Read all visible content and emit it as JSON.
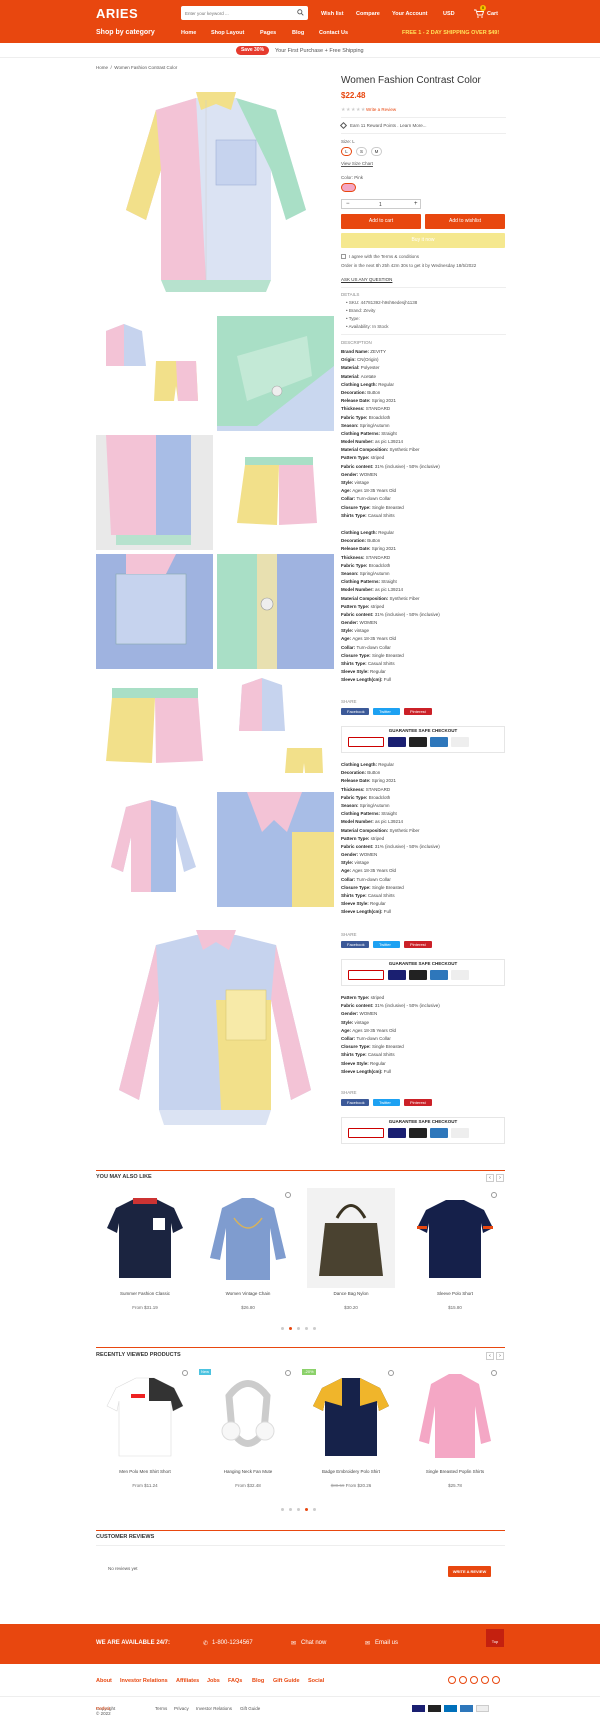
{
  "header": {
    "logo": "ARIES",
    "search_placeholder": "Enter your keyword ...",
    "wishlist": "Wish list",
    "compare": "Compare",
    "account": "Your Account",
    "currency": "USD",
    "cart": "Cart",
    "cart_count": "0"
  },
  "nav": {
    "category": "Shop by category",
    "items": [
      "Home",
      "Shop Layout",
      "Pages",
      "Blog",
      "Contact Us"
    ],
    "shipping": "FREE 1 - 2 DAY SHIPPING OVER $49!"
  },
  "promo": {
    "badge": "Save 30%",
    "text": "Your First Purchase + Free Shipping"
  },
  "breadcrumb": {
    "home": "Home",
    "current": "Women Fashion Contrast Color"
  },
  "product": {
    "title": "Women Fashion Contrast Color",
    "price": "$22.48",
    "write_review": "Write a Review",
    "rewards": "Earn 11 Reward Points . Learn More...",
    "size_label": "Size: L",
    "sizes": [
      "L",
      "S",
      "M"
    ],
    "size_chart": "View Size Chart",
    "color_label": "Color: Pink",
    "quantity": "1",
    "add_to_cart": "Add to cart",
    "add_to_wishlist": "Add to wishlist",
    "buy_now": "Buy it now",
    "terms": "I agree with the Terms & conditions",
    "order_text": "Order in the next 8h 25h 42m 30s to get it by Wednesday 18/5/2022",
    "ask": "ASK US ANY QUESTION",
    "details_label": "DETAILS",
    "details": [
      "SKU: 44781392-h9sh6edesjh1138",
      "Brand: Zevity",
      "Type:",
      "Availability: In Stock"
    ],
    "description_label": "DESCRIPTION",
    "share_label": "SHARE",
    "guarantee": "GUARANTEE SAFE CHECKOUT",
    "facebook": "Facebook",
    "twitter": "Twitter",
    "pinterest": "Pinterest"
  },
  "spec_main": [
    [
      "Brand Name:",
      "ZEVITY"
    ],
    [
      "Origin:",
      "CN(Origin)"
    ],
    [
      "Material:",
      "Polyester"
    ],
    [
      "Material:",
      "Acetate"
    ],
    [
      "Clothing Length:",
      "Regular"
    ],
    [
      "Decoration:",
      "Button"
    ],
    [
      "Release Date:",
      "Spring 2021"
    ],
    [
      "Thickness:",
      "STANDARD"
    ],
    [
      "Fabric Type:",
      "Broadcloth"
    ],
    [
      "Season:",
      "Spring/Autumn"
    ],
    [
      "Clothing Patterns:",
      "Straight"
    ],
    [
      "Model Number:",
      "as pic L39214"
    ],
    [
      "Material Composition:",
      "Synthetic Fiber"
    ],
    [
      "Pattern Type:",
      "striped"
    ],
    [
      "Fabric content:",
      "31% (inclusive) - 50% (inclusive)"
    ],
    [
      "Gender:",
      "WOMEN"
    ],
    [
      "Style:",
      "vintage"
    ],
    [
      "Age:",
      "Ages 18-35 Years Old"
    ],
    [
      "Collar:",
      "Turn-down Collar"
    ],
    [
      "Closure Type:",
      "Single Breasted"
    ],
    [
      "Shirts Type:",
      "Casual Shirts"
    ]
  ],
  "spec_b": [
    [
      "Clothing Length:",
      "Regular"
    ],
    [
      "Decoration:",
      "Button"
    ],
    [
      "Release Date:",
      "Spring 2021"
    ],
    [
      "Thickness:",
      "STANDARD"
    ],
    [
      "Fabric Type:",
      "Broadcloth"
    ],
    [
      "Season:",
      "Spring/Autumn"
    ],
    [
      "Clothing Patterns:",
      "Straight"
    ],
    [
      "Model Number:",
      "as pic L39214"
    ],
    [
      "Material Composition:",
      "Synthetic Fiber"
    ],
    [
      "Pattern Type:",
      "striped"
    ],
    [
      "Fabric content:",
      "31% (inclusive) - 50% (inclusive)"
    ],
    [
      "Gender:",
      "WOMEN"
    ],
    [
      "Style:",
      "vintage"
    ],
    [
      "Age:",
      "Ages 18-35 Years Old"
    ],
    [
      "Collar:",
      "Turn-down Collar"
    ],
    [
      "Closure Type:",
      "Single Breasted"
    ],
    [
      "Shirts Type:",
      "Casual Shirts"
    ],
    [
      "Sleeve Style:",
      "Regular"
    ],
    [
      "Sleeve Length(cm):",
      "Full"
    ]
  ],
  "spec_c": [
    [
      "Pattern Type:",
      "striped"
    ],
    [
      "Fabric content:",
      "31% (inclusive) - 50% (inclusive)"
    ],
    [
      "Gender:",
      "WOMEN"
    ],
    [
      "Style:",
      "vintage"
    ],
    [
      "Age:",
      "Ages 18-35 Years Old"
    ],
    [
      "Collar:",
      "Turn-down Collar"
    ],
    [
      "Closure Type:",
      "Single Breasted"
    ],
    [
      "Shirts Type:",
      "Casual Shirts"
    ],
    [
      "Sleeve Style:",
      "Regular"
    ],
    [
      "Sleeve Length(cm):",
      "Full"
    ]
  ],
  "also_like": {
    "title": "YOU MAY ALSO LIKE",
    "items": [
      {
        "name": "Summer Fashion Classic",
        "price": "From $31.19"
      },
      {
        "name": "Women Vintage Chain",
        "price": "$26.80"
      },
      {
        "name": "Dance Bag Nylon",
        "price": "$30.20"
      },
      {
        "name": "Sleeve Polo Short",
        "price": "$15.80"
      }
    ]
  },
  "recent": {
    "title": "RECENTLY VIEWED PRODUCTS",
    "items": [
      {
        "name": "Men Polo Men Shirt Short",
        "price": "From $11.24"
      },
      {
        "name": "Hanging Neck Fan Mute",
        "price": "From $32.48",
        "tag": "New"
      },
      {
        "name": "Badge Embroidery Polo Shirt",
        "old": "$80.59",
        "price": "From $20.26",
        "tag": "-20%"
      },
      {
        "name": "Single Breasted Poplin Shirts",
        "price": "$25.78"
      }
    ]
  },
  "reviews": {
    "title": "CUSTOMER REVIEWS",
    "none": "No reviews yet",
    "write": "WRITE A REVIEW"
  },
  "footer": {
    "available": "WE ARE AVAILABLE 24/7:",
    "phone": "1-800-1234567",
    "chat": "Chat now",
    "email": "Email us",
    "top": "Top",
    "links": [
      "About",
      "Investor Relations",
      "Affiliates",
      "Jobs",
      "FAQs",
      "Blog",
      "Gift Guide",
      "Social"
    ],
    "copyright": "Copyright © 2022",
    "brand": "Perfect",
    "bottom_links": [
      "Terms",
      "Privacy",
      "Investor Relations",
      "Gift Guide"
    ],
    "payments": [
      "VISA",
      "MC",
      "PP",
      "AMEX",
      "DISC"
    ]
  },
  "colors": {
    "accent": "#e8470f",
    "pink": "#f3a7c5",
    "yellow": "#f2e08a",
    "blue": "#8aa6d6",
    "green": "#9ed8bd"
  }
}
